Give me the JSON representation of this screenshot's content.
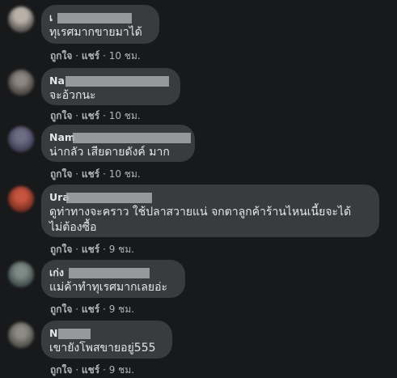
{
  "comments": [
    {
      "author_visible": "เ",
      "text": "ทุเรศมากขายมาได้",
      "like_label": "ถูกใจ",
      "reply_label": "แชร์",
      "time": "10 ชม."
    },
    {
      "author_visible": "Na",
      "text": "จะอ้วกนะ",
      "like_label": "ถูกใจ",
      "reply_label": "แชร์",
      "time": "10 ชม."
    },
    {
      "author_visible": "Nam",
      "text": "น่ากลัว เสียดายดังค์ มาก",
      "like_label": "ถูกใจ",
      "reply_label": "แชร์",
      "time": "10 ชม."
    },
    {
      "author_visible": "Ura",
      "text_lines": [
        "ดูท่าทางจะคราว ใช้ปลาสวายแน่ จกตาลูกค้าร้านไหนเนี้ยจะได้",
        "ไม่ต้องซื้อ"
      ],
      "like_label": "ถูกใจ",
      "reply_label": "แชร์",
      "time": "9 ชม."
    },
    {
      "author_visible": "เก่ง",
      "text": "แม่ค้าทำทุเรศมากเลยอ่ะ",
      "like_label": "ถูกใจ",
      "reply_label": "แชร์",
      "time": "9 ชม."
    },
    {
      "author_visible": "N",
      "text": "เขายังโพสขายอยู่555",
      "like_label": "ถูกใจ",
      "reply_label": "แชร์",
      "time": "9 ชม."
    }
  ],
  "separator": "·",
  "colors": {
    "background": "#18191a",
    "bubble": "#3a3b3c",
    "text": "#e4e6eb",
    "secondary_text": "#b0b3b8"
  }
}
